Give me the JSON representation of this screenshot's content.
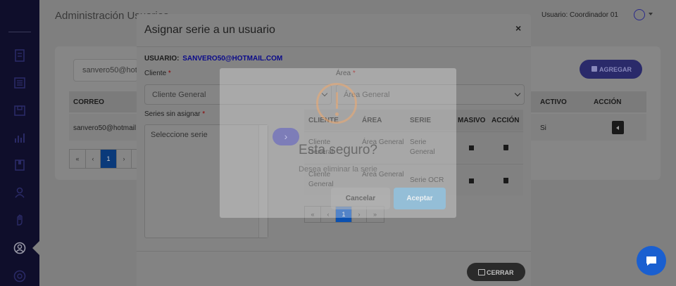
{
  "page": {
    "title": "Administración Usuarios",
    "user_label": "Usuario: Coordinador 01"
  },
  "sidebar": {
    "items": [
      "document-icon",
      "list-icon",
      "box-icon",
      "chart-icon",
      "book-icon",
      "person-icon",
      "hand-icon",
      "user-circle-icon",
      "globe-icon"
    ]
  },
  "background": {
    "search_value": "sanvero50@hot",
    "add_button": "AGREGAR",
    "columns": [
      "CORREO",
      "ACTIVO",
      "ACCIÓN"
    ],
    "rows": [
      {
        "correo": "sanvero50@hotmail",
        "activo": "Si"
      }
    ],
    "pagination": [
      "«",
      "‹",
      "1",
      "›"
    ]
  },
  "modal": {
    "title": "Asignar serie a un usuario",
    "close_glyph": "×",
    "user_label": "USUARIO:",
    "user_value": "SANVERO50@HOTMAIL.COM",
    "cliente_label": "Cliente",
    "cliente_value": "Cliente General",
    "area_label": "Área",
    "area_value": "Área General",
    "series_label": "Series sin asignar",
    "series_placeholder": "Seleccione serie",
    "transfer_glyph": "›",
    "required_mark": "*",
    "table": {
      "headers": [
        "CLIENTE",
        "ÁREA",
        "SERIE",
        "MASIVO",
        "ACCIÓN"
      ],
      "rows": [
        {
          "cliente": "Cliente General",
          "area": "Área General",
          "serie": "Serie General",
          "masivo": "checked"
        },
        {
          "cliente": "Cliente General",
          "area": "Área General",
          "serie": "Serie OCR",
          "masivo": "unchecked"
        }
      ]
    },
    "pagination": [
      "«",
      "‹",
      "1",
      "›",
      "»"
    ],
    "close_button": "CERRAR"
  },
  "alert": {
    "title": "Esta seguro?",
    "text": "Desea eliminar la serie",
    "cancel": "Cancelar",
    "confirm": "Aceptar",
    "icon": "warning-icon"
  },
  "colors": {
    "sidebar": "#0f0e2b",
    "primary": "#2a2a6a",
    "confirm": "#8cc8eb",
    "warning": "#f0aa6e",
    "chat": "#1a5fd0"
  }
}
